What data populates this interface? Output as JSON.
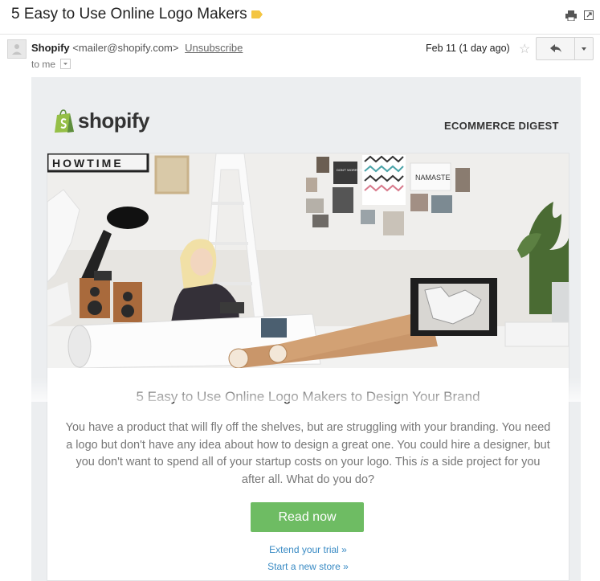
{
  "email": {
    "subject": "5 Easy to Use Online Logo Makers",
    "sender_name": "Shopify",
    "sender_email": "<mailer@shopify.com>",
    "unsubscribe": "Unsubscribe",
    "to": "to me",
    "date": "Feb 11 (1 day ago)"
  },
  "newsletter": {
    "brand": "shopify",
    "section": "ECOMMERCE DIGEST",
    "wall_sign_1": "HOWTIME",
    "wall_sign_2": "NAMASTE",
    "wall_card": "DON'T WORRY BE HAPPY",
    "article_title": "5 Easy to Use Online Logo Makers to Design Your Brand",
    "body_part1": "You have a product that will fly off the shelves, but are struggling with your branding. You need a logo but don't have any idea about how to design a great one. You could hire a designer, but you don't want to spend all of your startup costs on your logo. This ",
    "body_emph": "is",
    "body_part2": " a side project for you after all. What do you do?",
    "cta": "Read now",
    "link_trial": "Extend your trial »",
    "link_store": "Start a new store »"
  },
  "icons": [
    "label-icon",
    "print-icon",
    "new-window-icon",
    "avatar-icon",
    "dropdown-caret-icon",
    "star-icon",
    "reply-icon",
    "more-options-icon",
    "shopify-bag-icon"
  ],
  "colors": {
    "accent_green": "#6ebc63",
    "link_blue": "#3a8bc4",
    "label_yellow": "#f4c542",
    "email_bg": "#eceef0"
  }
}
